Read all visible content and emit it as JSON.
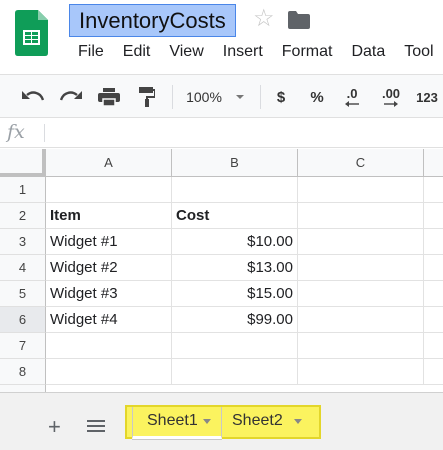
{
  "document": {
    "title": "InventoryCosts"
  },
  "menu": [
    "File",
    "Edit",
    "View",
    "Insert",
    "Format",
    "Data",
    "Tool"
  ],
  "toolbar": {
    "zoom": "100%",
    "currency_label": "$",
    "percent_label": "%",
    "decrease_decimals_label": ".0",
    "increase_decimals_label": ".00",
    "more_formats_label": "123"
  },
  "formula_bar": {
    "fx_label": "fx",
    "value": ""
  },
  "grid": {
    "columns": [
      "A",
      "B",
      "C"
    ],
    "rows": [
      "1",
      "2",
      "3",
      "4",
      "5",
      "6",
      "7",
      "8"
    ],
    "cells": [
      [
        "",
        "",
        ""
      ],
      [
        "Item",
        "Cost",
        ""
      ],
      [
        "Widget #1",
        "$10.00",
        ""
      ],
      [
        "Widget #2",
        "$13.00",
        ""
      ],
      [
        "Widget #3",
        "$15.00",
        ""
      ],
      [
        "Widget #4",
        "$99.00",
        ""
      ],
      [
        "",
        "",
        ""
      ],
      [
        "",
        "",
        ""
      ]
    ]
  },
  "sheets": [
    "Sheet1",
    "Sheet2"
  ],
  "colors": {
    "title_highlight": "#a8c7fa",
    "sheet_highlight": "#fbf35f",
    "logo_green": "#0f9d58"
  },
  "icons": [
    "sheets-logo-icon",
    "star-icon",
    "folder-icon",
    "undo-icon",
    "redo-icon",
    "print-icon",
    "paint-format-icon",
    "add-sheet-icon",
    "all-sheets-icon"
  ]
}
